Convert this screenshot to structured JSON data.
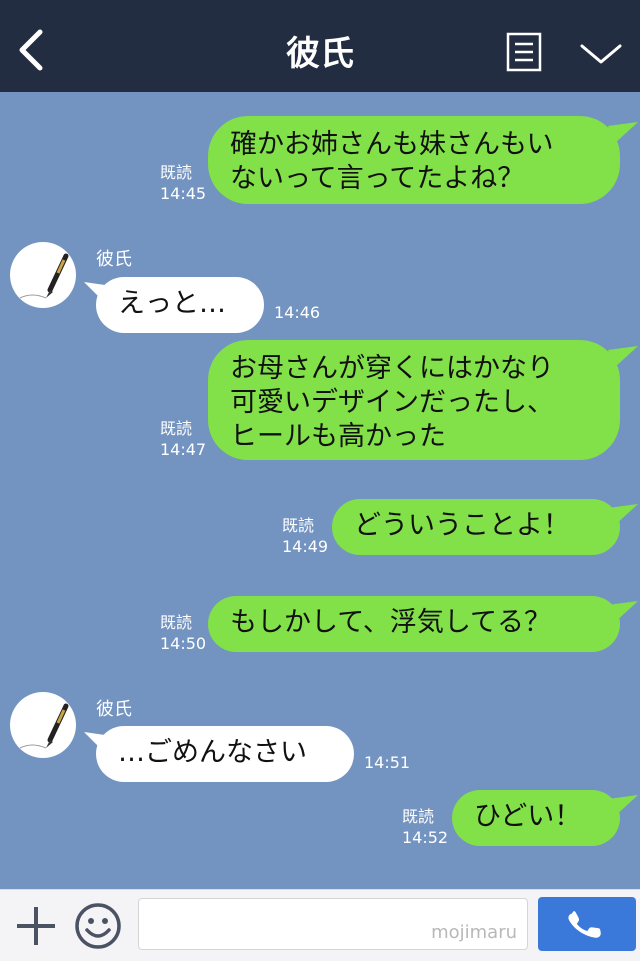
{
  "header": {
    "title": "彼氏",
    "back_icon": "chevron-left-icon",
    "menu_icon": "memo-icon",
    "more_icon": "chevron-down-icon"
  },
  "messages": [
    {
      "side": "right",
      "lines": [
        "確かお姉さんも妹さんもい",
        "ないって言ってたよね？"
      ],
      "read": "既読",
      "time": "14:45"
    },
    {
      "side": "left",
      "sender": "彼氏",
      "lines": [
        "えっと…"
      ],
      "time": "14:46"
    },
    {
      "side": "right",
      "lines": [
        "お母さんが穿くにはかなり",
        "可愛いデザインだったし、",
        "ヒールも高かった"
      ],
      "read": "既読",
      "time": "14:47"
    },
    {
      "side": "right",
      "lines": [
        "どういうことよ！"
      ],
      "read": "既読",
      "time": "14:49"
    },
    {
      "side": "right",
      "lines": [
        "もしかして、浮気してる？"
      ],
      "read": "既読",
      "time": "14:50"
    },
    {
      "side": "left",
      "sender": "彼氏",
      "lines": [
        "…ごめんなさい"
      ],
      "time": "14:51"
    },
    {
      "side": "right",
      "lines": [
        "ひどい！"
      ],
      "read": "既読",
      "time": "14:52"
    }
  ],
  "footer": {
    "plus_icon": "plus-icon",
    "emoji_icon": "smiley-icon",
    "input_value": "",
    "watermark": "mojimaru",
    "call_icon": "phone-icon"
  },
  "colors": {
    "header_bg": "#232d41",
    "chat_bg": "#7394c0",
    "my_bubble": "#82e048",
    "their_bubble": "#ffffff",
    "call_button": "#3a79d9"
  }
}
